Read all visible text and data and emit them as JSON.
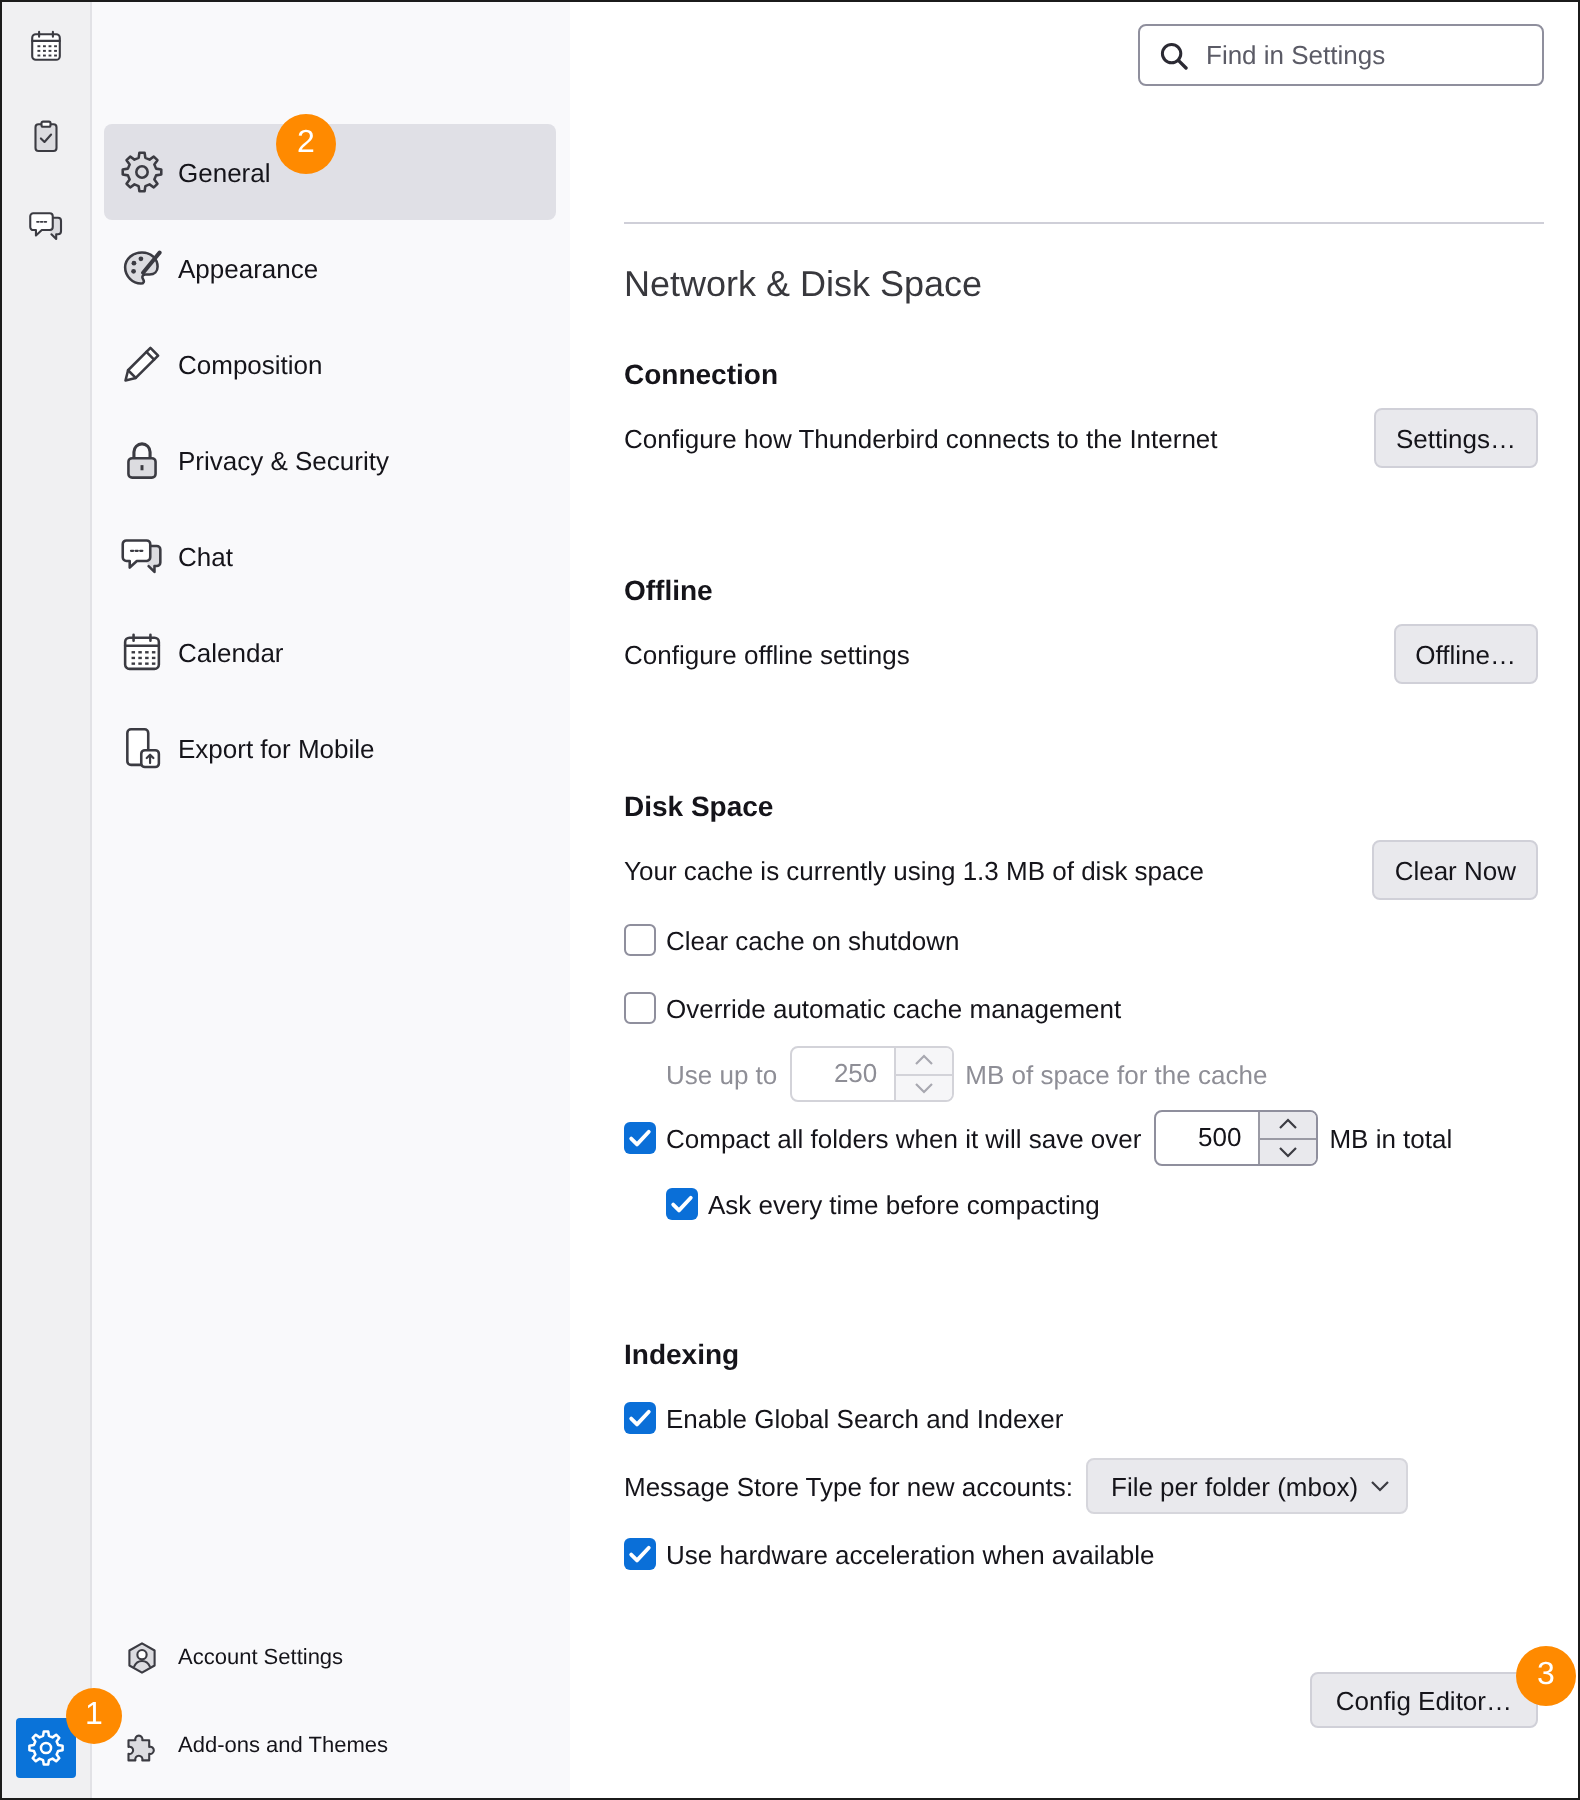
{
  "spaces_toolbar": {
    "items": [
      {
        "kind": "calendar",
        "selected": false
      },
      {
        "kind": "tasks",
        "selected": false
      },
      {
        "kind": "chat",
        "selected": false
      }
    ],
    "bottom_items": [
      {
        "kind": "settings",
        "selected": true,
        "badge": "1"
      }
    ]
  },
  "sidebar": {
    "items": [
      {
        "kind": "general",
        "label": "General",
        "selected": true,
        "badge": "2"
      },
      {
        "kind": "appearance",
        "label": "Appearance",
        "selected": false
      },
      {
        "kind": "composition",
        "label": "Composition",
        "selected": false
      },
      {
        "kind": "privacy",
        "label": "Privacy & Security",
        "selected": false
      },
      {
        "kind": "chat",
        "label": "Chat",
        "selected": false
      },
      {
        "kind": "calendar",
        "label": "Calendar",
        "selected": false
      },
      {
        "kind": "mobile",
        "label": "Export for Mobile",
        "selected": false
      }
    ],
    "footer_links": [
      {
        "kind": "account",
        "label": "Account Settings"
      },
      {
        "kind": "addons",
        "label": "Add-ons and Themes"
      }
    ]
  },
  "search": {
    "placeholder": "Find in Settings"
  },
  "page_title": "Network & Disk Space",
  "sections": [
    {
      "title": "Connection",
      "rows": [
        {
          "kind": "action",
          "text": "Configure how Thunderbird connects to the Internet",
          "button": "Settings…"
        }
      ]
    },
    {
      "title": "Offline",
      "rows": [
        {
          "kind": "action",
          "text": "Configure offline settings",
          "button": "Offline…"
        }
      ]
    },
    {
      "title": "Disk Space",
      "rows": [
        {
          "kind": "action",
          "text": "Your cache is currently using 1.3 MB of disk space",
          "button": "Clear Now"
        },
        {
          "kind": "checkbox",
          "label": "Clear cache on shutdown",
          "checked": false
        },
        {
          "kind": "checkbox",
          "label": "Override automatic cache management",
          "checked": false,
          "children": [
            {
              "kind": "number",
              "label": "Use up to",
              "value": "250",
              "suffix": "MB of space for the cache",
              "disabled": true
            }
          ]
        },
        {
          "kind": "checkbox",
          "label": "Compact all folders when it will save over",
          "checked": true,
          "value": "500",
          "suffix": "MB in total",
          "children": [
            {
              "kind": "checkbox",
              "label": "Ask every time before compacting",
              "checked": true
            }
          ]
        }
      ]
    },
    {
      "title": "Indexing",
      "rows": [
        {
          "kind": "checkbox",
          "label": "Enable Global Search and Indexer",
          "checked": true
        },
        {
          "kind": "select",
          "label": "Message Store Type for new accounts:",
          "value": "File per folder (mbox)"
        },
        {
          "kind": "checkbox",
          "label": "Use hardware acceleration when available",
          "checked": true
        }
      ]
    }
  ],
  "footer_button": {
    "label": "Config Editor…",
    "badge": "3"
  }
}
